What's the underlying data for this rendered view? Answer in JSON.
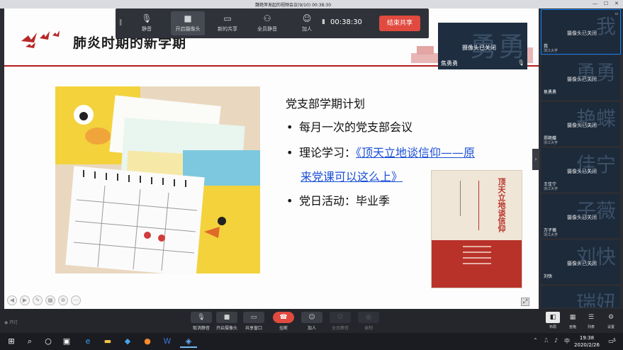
{
  "window": {
    "title": "魏艳萍发起的视频会议(9/10)  00:38:30"
  },
  "toolbar": {
    "items": [
      {
        "label": "静音",
        "icon": "mic-icon"
      },
      {
        "label": "开启摄像头",
        "icon": "camera-icon"
      },
      {
        "label": "新的共享",
        "icon": "share-screen-icon"
      },
      {
        "label": "全员静音",
        "icon": "mute-all-icon"
      },
      {
        "label": "加人",
        "icon": "add-person-icon"
      }
    ],
    "timer": "00:38:30",
    "end_share": "结束共享"
  },
  "slide": {
    "title": "肺炎时期的新学期",
    "plan_heading": "党支部学期计划",
    "bullets": {
      "b1": "每月一次的党支部会议",
      "b2_prefix": "理论学习：",
      "b2_link_1": "《顶天立地谈信仰——原",
      "b2_link_2": "来党课可以这么上》",
      "b3": "党日活动：毕业季"
    },
    "book_title": "顶天立地谈信仰"
  },
  "self_tile": {
    "big": "勇勇",
    "status": "摄像头已关闭",
    "name": "焦勇勇"
  },
  "participants": [
    {
      "big": "我",
      "status": "摄像头已关闭",
      "name": "我",
      "org": "浙江大学"
    },
    {
      "big": "勇勇",
      "status": "摄像头已关闭",
      "name": "焦勇勇",
      "org": ""
    },
    {
      "big": "艳蝶",
      "status": "摄像头已关闭",
      "name": "郑艳蝶",
      "org": "浙江大学"
    },
    {
      "big": "佳宁",
      "status": "摄像头已关闭",
      "name": "王佳宁",
      "org": "浙江大学"
    },
    {
      "big": "子薇",
      "status": "摄像头已关闭",
      "name": "万子薇",
      "org": "浙江大学"
    },
    {
      "big": "刘快",
      "status": "摄像头已关闭",
      "name": "刘快",
      "org": ""
    },
    {
      "big": "瑞妞",
      "status": "",
      "name": "",
      "org": ""
    }
  ],
  "bottom": {
    "left_text": "开灯",
    "items": [
      {
        "label": "取消静音"
      },
      {
        "label": "开启摄像头"
      },
      {
        "label": "共享窗口"
      },
      {
        "label": "挂断"
      },
      {
        "label": "加人"
      },
      {
        "label": "全员静音"
      },
      {
        "label": "录制"
      }
    ],
    "right_items": [
      {
        "label": "布局"
      },
      {
        "label": "宫格"
      },
      {
        "label": "列表"
      },
      {
        "label": "设置"
      }
    ]
  },
  "taskbar": {
    "tray_ime": "中",
    "time": "19:38",
    "date": "2020/2/26",
    "notif_count": "5"
  }
}
